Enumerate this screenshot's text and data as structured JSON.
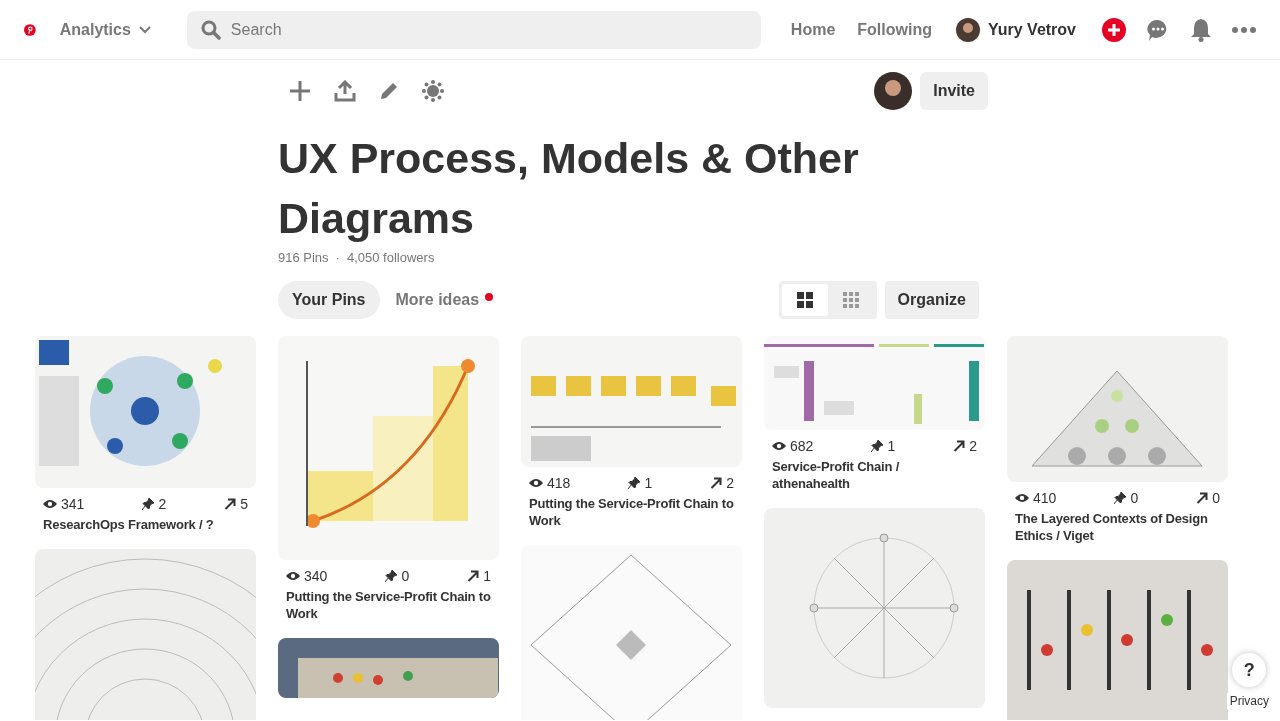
{
  "header": {
    "menu_label": "Analytics",
    "search": {
      "placeholder": "Search"
    },
    "nav": [
      "Home",
      "Following"
    ],
    "user_name": "Yury Vetrov"
  },
  "board": {
    "title": "UX Process, Models & Other Diagrams",
    "pins_count": "916 Pins",
    "separator": "·",
    "followers": "4,050 followers",
    "invite_label": "Invite",
    "tabs": [
      {
        "label": "Your Pins",
        "selected": true,
        "has_new": false
      },
      {
        "label": "More ideas",
        "selected": false,
        "has_new": true
      }
    ],
    "views": [
      {
        "kind": "large",
        "selected": true
      },
      {
        "kind": "small",
        "selected": false
      }
    ],
    "organize_label": "Organize"
  },
  "columns": [
    {
      "pins": [
        {
          "kind": "pin",
          "views": "341",
          "saves": "2",
          "repins": "5",
          "title": "ResearchOps Framework / ?"
        },
        {
          "kind": "picture"
        }
      ]
    },
    {
      "pins": [
        {
          "kind": "pin",
          "views": "340",
          "saves": "0",
          "repins": "1",
          "title": "Putting the Service-Profit Chain to Work"
        },
        {
          "kind": "picture"
        }
      ]
    },
    {
      "pins": [
        {
          "kind": "pin",
          "views": "418",
          "saves": "1",
          "repins": "2",
          "title": "Putting the Service-Profit Chain to Work"
        },
        {
          "kind": "picture"
        }
      ]
    },
    {
      "pins": [
        {
          "kind": "pin",
          "views": "682",
          "saves": "1",
          "repins": "2",
          "title": "Service-Profit Chain / athenahealth"
        },
        {
          "kind": "picture"
        }
      ]
    },
    {
      "pins": [
        {
          "kind": "pin",
          "views": "410",
          "saves": "0",
          "repins": "0",
          "title": "The Layered Contexts of Design Ethics / Viget"
        },
        {
          "kind": "picture"
        }
      ]
    }
  ],
  "help_label": "?",
  "privacy_label": "Privacy"
}
